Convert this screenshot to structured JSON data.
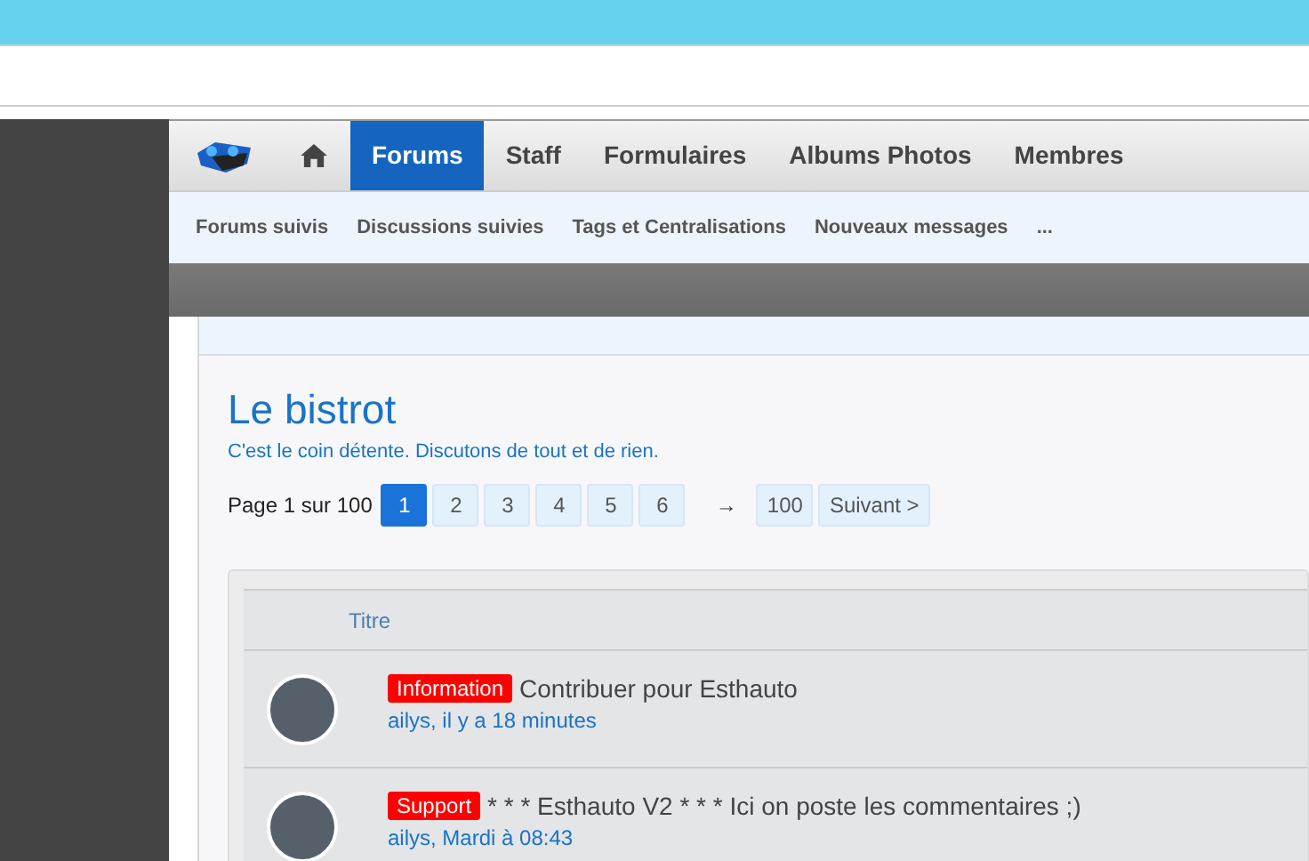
{
  "nav": {
    "tabs": [
      {
        "label": "Forums",
        "selected": true
      },
      {
        "label": "Staff",
        "selected": false
      },
      {
        "label": "Formulaires",
        "selected": false
      },
      {
        "label": "Albums Photos",
        "selected": false
      },
      {
        "label": "Membres",
        "selected": false
      }
    ]
  },
  "subnav": [
    "Forums suivis",
    "Discussions suivies",
    "Tags et Centralisations",
    "Nouveaux messages",
    "..."
  ],
  "forum": {
    "title": "Le bistrot",
    "description": "C'est le coin détente. Discutons de tout et de rien."
  },
  "pagination": {
    "label": "Page 1 sur 100",
    "pages": [
      {
        "label": "1",
        "selected": true
      },
      {
        "label": "2",
        "selected": false
      },
      {
        "label": "3",
        "selected": false
      },
      {
        "label": "4",
        "selected": false
      },
      {
        "label": "5",
        "selected": false
      },
      {
        "label": "6",
        "selected": false
      }
    ],
    "skip": "→",
    "last": "100",
    "next": "Suivant >"
  },
  "threads": {
    "column": "Titre",
    "rows": [
      {
        "prefix": "Information",
        "color": "#ff0000",
        "title": "Contribuer pour Esthauto",
        "meta": "ailys, il y a 18 minutes"
      },
      {
        "prefix": "Support",
        "color": "#ff0000",
        "title": "* * * Esthauto V2 * * * Ici on poste les commentaires ;)",
        "meta": "ailys, Mardi à 08:43"
      }
    ]
  }
}
